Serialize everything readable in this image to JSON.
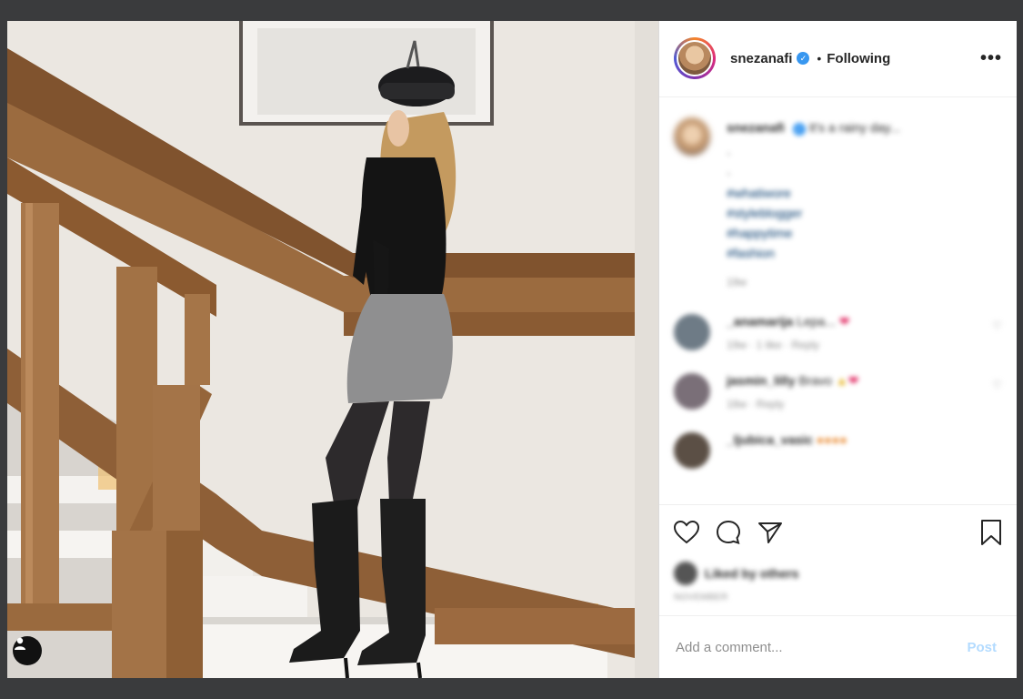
{
  "post": {
    "username": "snezanafi",
    "follow_status": "Following",
    "more_icon": "more-horizontal-icon",
    "user_tag_icon": "user-tag-icon"
  },
  "caption": {
    "username": "snezanafi",
    "text": "It's a rainy day...",
    "hashtags": [
      "#whatiwore",
      "#styleblogger",
      "#happytime",
      "#fashion"
    ],
    "time": "19w"
  },
  "comments": [
    {
      "user": "_anamarija",
      "text": "Lepa...",
      "meta": "19w · 1 like · Reply"
    },
    {
      "user": "jasmin_lilly",
      "text": "Bravo",
      "meta": "18w · Reply"
    },
    {
      "user": "_ljubica_vasic",
      "text": "",
      "meta": ""
    }
  ],
  "actions": {
    "like_icon": "heart-icon",
    "comment_icon": "comment-icon",
    "share_icon": "share-icon",
    "save_icon": "bookmark-icon"
  },
  "likes": {
    "text": "Liked by others"
  },
  "date": "NOVEMBER",
  "add_comment": {
    "placeholder": "Add a comment...",
    "post_label": "Post"
  }
}
